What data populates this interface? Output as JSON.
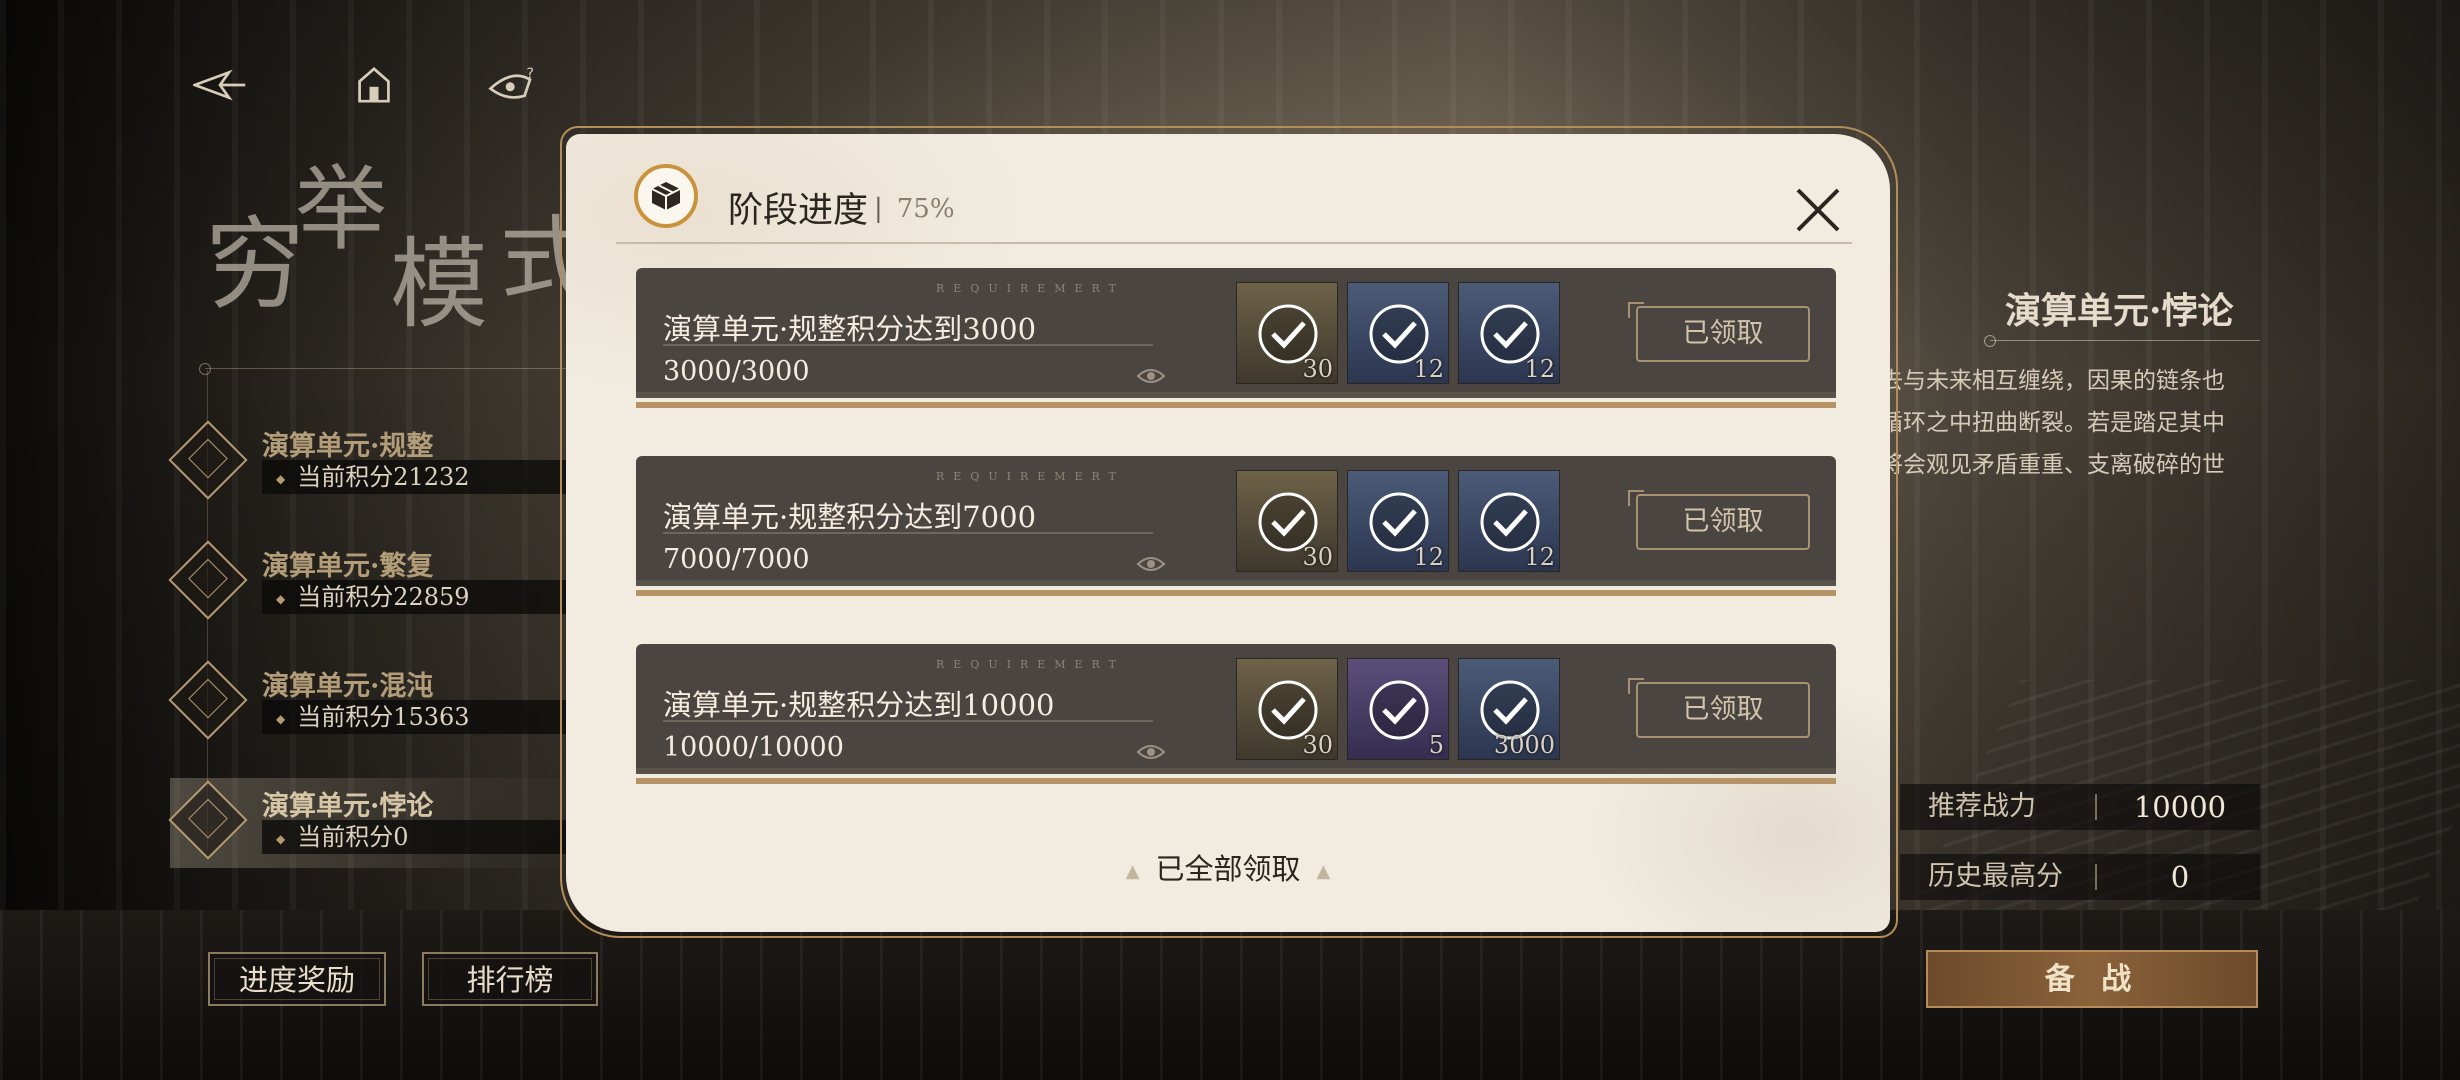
{
  "background": {
    "accent": "#b48e58"
  },
  "nav": {
    "icons": [
      "back-icon",
      "home-icon",
      "help-icon"
    ]
  },
  "mode": {
    "title_chars": [
      "穷",
      "举",
      "模",
      "式"
    ]
  },
  "units": [
    {
      "name": "演算单元·规整",
      "score": "当前积分21232"
    },
    {
      "name": "演算单元·繁复",
      "score": "当前积分22859"
    },
    {
      "name": "演算单元·混沌",
      "score": "当前积分15363"
    },
    {
      "name": "演算单元·悖论",
      "score": "当前积分0"
    }
  ],
  "bottom_buttons": {
    "progress_reward": "进度奖励",
    "leaderboard": "排行榜"
  },
  "stage": {
    "title": "演算单元·悖论",
    "description_lines": [
      "去与未来相互缠绕，因果的链条也",
      "循环之中扭曲断裂。若是踏足其中",
      "将会观见矛盾重重、支离破碎的世"
    ],
    "recommended_power_label": "推荐战力",
    "recommended_power_value": "10000",
    "best_score_label": "历史最高分",
    "best_score_value": "0",
    "battle_button": "备 战"
  },
  "modal": {
    "title": "阶段进度",
    "progress_percent": "75%",
    "requirement_caption": "REQUIREMERT",
    "claimed_label": "已领取",
    "all_claimed_label": "已全部领取",
    "requirements": [
      {
        "text": "演算单元·规整积分达到3000",
        "progress": "3000/3000",
        "rewards": [
          {
            "qty": "30",
            "rarity": "gold"
          },
          {
            "qty": "12",
            "rarity": "blue"
          },
          {
            "qty": "12",
            "rarity": "blue"
          }
        ]
      },
      {
        "text": "演算单元·规整积分达到7000",
        "progress": "7000/7000",
        "rewards": [
          {
            "qty": "30",
            "rarity": "gold"
          },
          {
            "qty": "12",
            "rarity": "blue"
          },
          {
            "qty": "12",
            "rarity": "blue"
          }
        ]
      },
      {
        "text": "演算单元·规整积分达到10000",
        "progress": "10000/10000",
        "rewards": [
          {
            "qty": "30",
            "rarity": "gold"
          },
          {
            "qty": "5",
            "rarity": "purple"
          },
          {
            "qty": "3000",
            "rarity": "blue"
          }
        ]
      }
    ]
  }
}
